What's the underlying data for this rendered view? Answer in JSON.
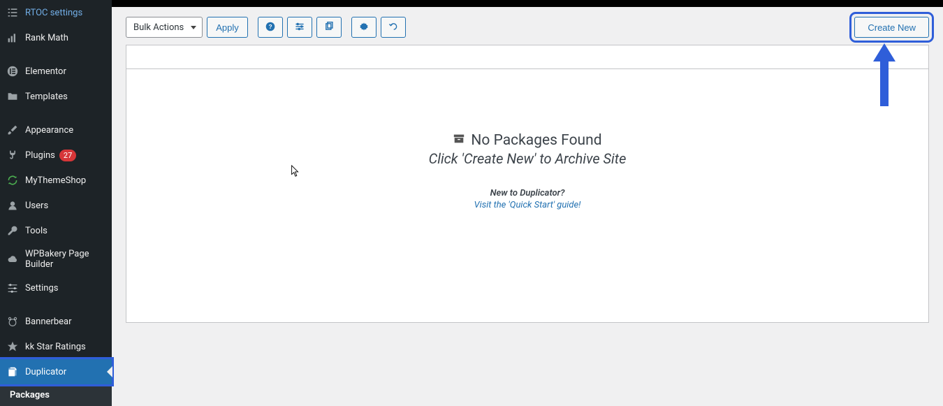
{
  "sidebar": {
    "items": [
      {
        "label": "RTOC settings"
      },
      {
        "label": "Rank Math"
      },
      {
        "label": "Elementor"
      },
      {
        "label": "Templates"
      },
      {
        "label": "Appearance"
      },
      {
        "label": "Plugins",
        "count": "27"
      },
      {
        "label": "MyThemeShop"
      },
      {
        "label": "Users"
      },
      {
        "label": "Tools"
      },
      {
        "label": "WPBakery Page Builder"
      },
      {
        "label": "Settings"
      },
      {
        "label": "Bannerbear"
      },
      {
        "label": "kk Star Ratings"
      },
      {
        "label": "Duplicator"
      }
    ],
    "submenu": {
      "label": "Packages"
    }
  },
  "toolbar": {
    "bulk_actions": "Bulk Actions",
    "apply": "Apply",
    "create_new": "Create New"
  },
  "empty": {
    "heading": "No Packages Found",
    "sub": "Click 'Create New' to Archive Site",
    "small": "New to Duplicator?",
    "link": "Visit the 'Quick Start' guide!"
  }
}
